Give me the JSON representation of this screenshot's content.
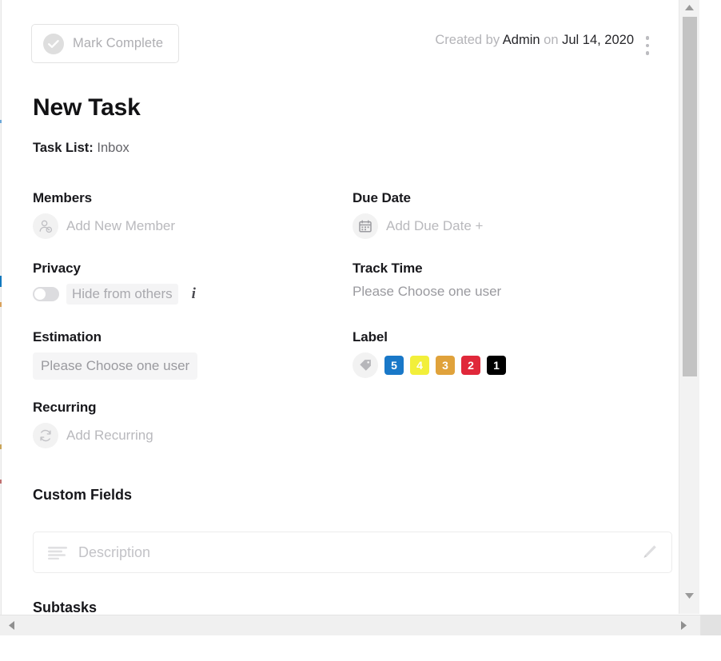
{
  "header": {
    "mark_complete_label": "Mark Complete",
    "mark_complete_icon": "check-circle-icon",
    "created_prefix": "Created by ",
    "created_author": "Admin",
    "created_middle": " on ",
    "created_date": "Jul 14, 2020",
    "menu_icon": "kebab-menu-icon"
  },
  "task": {
    "title": "New Task",
    "task_list_label": "Task List:",
    "task_list_value": "Inbox"
  },
  "fields": {
    "members": {
      "label": "Members",
      "action": "Add New Member",
      "icon": "add-member-icon"
    },
    "due_date": {
      "label": "Due Date",
      "action": "Add Due Date +",
      "icon": "calendar-icon"
    },
    "privacy": {
      "label": "Privacy",
      "toggle_state": "off",
      "toggle_text": "Hide from others",
      "info_icon": "info-icon"
    },
    "track_time": {
      "label": "Track Time",
      "value": "Please Choose one user"
    },
    "estimation": {
      "label": "Estimation",
      "value": "Please Choose one user"
    },
    "label": {
      "label": "Label",
      "icon": "tag-icon",
      "chips": [
        {
          "text": "5",
          "color": "#1978c8",
          "fg": "#ffffff"
        },
        {
          "text": "4",
          "color": "#f2ef3a",
          "fg": "#ffffff"
        },
        {
          "text": "3",
          "color": "#e0a23b",
          "fg": "#ffffff"
        },
        {
          "text": "2",
          "color": "#e0283a",
          "fg": "#ffffff"
        },
        {
          "text": "1",
          "color": "#000000",
          "fg": "#ffffff"
        }
      ]
    },
    "recurring": {
      "label": "Recurring",
      "action": "Add Recurring",
      "icon": "refresh-icon"
    }
  },
  "custom_fields": {
    "heading": "Custom Fields",
    "description_icon": "text-lines-icon",
    "description_placeholder": "Description",
    "edit_icon": "pencil-icon"
  },
  "subtasks": {
    "heading": "Subtasks"
  },
  "scrollbars": {
    "v_up_icon": "triangle-up-icon",
    "v_down_icon": "triangle-down-icon",
    "h_left_icon": "triangle-left-icon",
    "h_right_icon": "triangle-right-icon"
  }
}
